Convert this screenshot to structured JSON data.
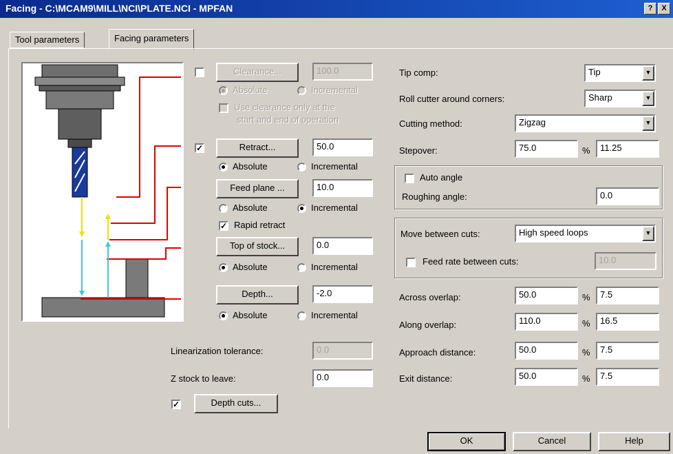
{
  "window": {
    "title": "Facing - C:\\MCAM9\\MILL\\NCI\\PLATE.NCI - MPFAN",
    "help_btn": "?",
    "close_btn": "X"
  },
  "tabs": [
    "Tool parameters",
    "Facing parameters"
  ],
  "left": {
    "clearance": {
      "label": "Clearance...",
      "value": "100.0",
      "absolute": "Absolute",
      "incremental": "Incremental",
      "use_label_1": "Use clearance only at the",
      "use_label_2": "start and end of operation"
    },
    "retract": {
      "label": "Retract...",
      "value": "50.0",
      "absolute": "Absolute",
      "incremental": "Incremental"
    },
    "feed_plane": {
      "label": "Feed plane ...",
      "value": "10.0",
      "absolute": "Absolute",
      "incremental": "Incremental"
    },
    "rapid_retract": "Rapid retract",
    "top_of_stock": {
      "label": "Top of stock...",
      "value": "0.0",
      "absolute": "Absolute",
      "incremental": "Incremental"
    },
    "depth": {
      "label": "Depth...",
      "value": "-2.0",
      "absolute": "Absolute",
      "incremental": "Incremental"
    },
    "lin_tol": {
      "label": "Linearization tolerance:",
      "value": "0.0"
    },
    "z_stock": {
      "label": "Z stock to leave:",
      "value": "0.0"
    },
    "depth_cuts": "Depth cuts..."
  },
  "right": {
    "tip_comp": {
      "label": "Tip comp:",
      "value": "Tip"
    },
    "roll_cutter": {
      "label": "Roll cutter around corners:",
      "value": "Sharp"
    },
    "cutting_method": {
      "label": "Cutting method:",
      "value": "Zigzag"
    },
    "stepover": {
      "label": "Stepover:",
      "percent": "75.0",
      "value": "11.25"
    },
    "auto_angle": "Auto angle",
    "roughing_angle": {
      "label": "Roughing angle:",
      "value": "0.0"
    },
    "move_between": {
      "label": "Move between cuts:",
      "value": "High speed loops"
    },
    "feed_between": {
      "label": "Feed rate between cuts:",
      "value": "10.0"
    },
    "across_overlap": {
      "label": "Across overlap:",
      "percent": "50.0",
      "value": "7.5"
    },
    "along_overlap": {
      "label": "Along overlap:",
      "percent": "110.0",
      "value": "16.5"
    },
    "approach": {
      "label": "Approach distance:",
      "percent": "50.0",
      "value": "7.5"
    },
    "exit": {
      "label": "Exit distance:",
      "percent": "50.0",
      "value": "7.5"
    },
    "pct": "%"
  },
  "buttons": {
    "ok": "OK",
    "cancel": "Cancel",
    "help": "Help"
  },
  "colors": {
    "path_red": "#e00000",
    "path_yellow": "#f0e000",
    "path_cyan": "#40c8d8"
  }
}
